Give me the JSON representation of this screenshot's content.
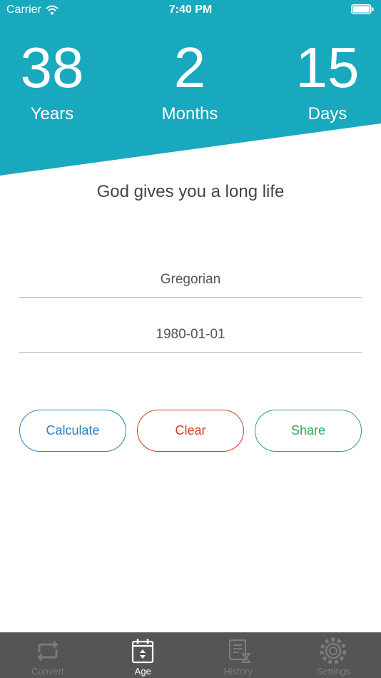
{
  "colors": {
    "accent": "#19a9be",
    "tabbar": "#555555",
    "tab_active": "#ffffff",
    "tab_inactive": "#7b7b7b",
    "calculate": "#2a7fc0",
    "clear": "#d2392b",
    "share": "#2ba856"
  },
  "status_bar": {
    "carrier": "Carrier",
    "time": "7:40 PM"
  },
  "age": {
    "years": "38",
    "years_label": "Years",
    "months": "2",
    "months_label": "Months",
    "days": "15",
    "days_label": "Days"
  },
  "greeting": "God gives you a long life",
  "form": {
    "calendar_value": "Gregorian",
    "birth_date_value": "1980-01-01"
  },
  "buttons": {
    "calculate": "Calculate",
    "clear": "Clear",
    "share": "Share"
  },
  "tabs": [
    {
      "label": "Convert",
      "icon": "convert-arrows-icon",
      "active": false
    },
    {
      "label": "Age",
      "icon": "calendar-icon",
      "active": true
    },
    {
      "label": "History",
      "icon": "history-scroll-icon",
      "active": false
    },
    {
      "label": "Settings",
      "icon": "gear-icon",
      "active": false
    }
  ]
}
